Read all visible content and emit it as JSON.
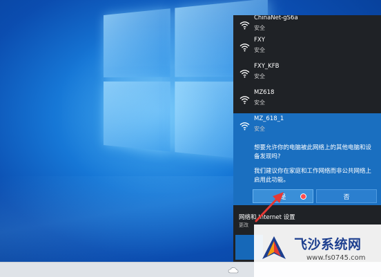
{
  "colors": {
    "panel_bg": "#1f2226",
    "selected_bg": "#1a6fc0",
    "button_bg": "#3a8fd8",
    "accent_red": "#e53935",
    "brand_blue": "#1d3f8f"
  },
  "wifi_list": {
    "networks": [
      {
        "name": "ChinaNet-gS6a",
        "security": "安全"
      },
      {
        "name": "FXY",
        "security": "安全"
      },
      {
        "name": "FXY_KFB",
        "security": "安全"
      },
      {
        "name": "MZ618",
        "security": "安全"
      }
    ],
    "selected": {
      "name": "MZ_618_1",
      "security": "安全",
      "prompt": "想要允许你的电脑被此网络上的其他电脑和设备发现吗?",
      "advice": "我们建议你在家庭和工作网络而非公共网络上启用此功能。",
      "yes_label": "是",
      "no_label": "否"
    }
  },
  "settings": {
    "title": "网络和 Internet 设置",
    "subtitle": "更改"
  },
  "watermark": {
    "name": "飞沙系统网",
    "url": "www.fs0745.com"
  },
  "icons": {
    "network": "wifi-icon",
    "pointer": "red-arrow-icon",
    "brand": "fs-logo-icon"
  }
}
